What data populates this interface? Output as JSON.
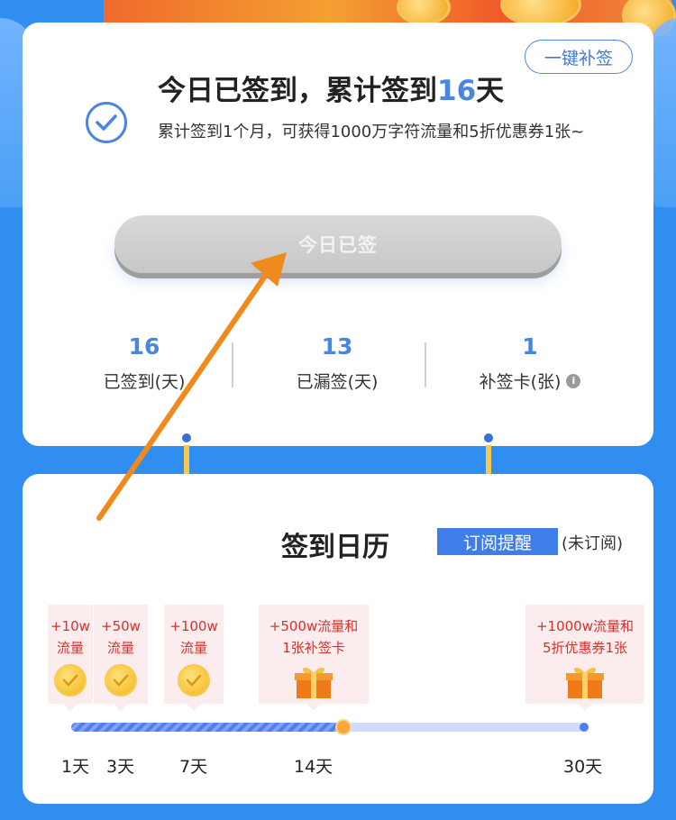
{
  "top_card": {
    "makeup_all_label": "一键补签",
    "headline_prefix": "今日已签到，累计签到",
    "headline_days": "16",
    "headline_suffix": "天",
    "description": "累计签到1个月，可获得1000万字符流量和5折优惠券1张~",
    "signed_button_label": "今日已签",
    "stats": [
      {
        "value": "16",
        "label": "已签到(天)"
      },
      {
        "value": "13",
        "label": "已漏签(天)"
      },
      {
        "value": "1",
        "label": "补签卡(张)"
      }
    ]
  },
  "calendar": {
    "title": "签到日历",
    "subscribe_label": "订阅提醒",
    "subscribe_status": "(未订阅)",
    "progress_fraction": 0.53,
    "rewards": [
      {
        "text": "+10w流量",
        "day_label": "1天",
        "icon": "gold-check-icon"
      },
      {
        "text": "+50w流量",
        "day_label": "3天",
        "icon": "gold-check-icon"
      },
      {
        "text": "+100w流量",
        "day_label": "7天",
        "icon": "gold-check-icon"
      },
      {
        "text": "+500w流量和1张补签卡",
        "day_label": "14天",
        "icon": "gift-icon"
      },
      {
        "text": "+1000w流量和5折优惠券1张",
        "day_label": "30天",
        "icon": "gift-icon"
      }
    ]
  },
  "colors": {
    "accent": "#4a86e0",
    "background": "#2f8ef0",
    "reward_text": "#d6322d",
    "arrow": "#f08a1c"
  }
}
